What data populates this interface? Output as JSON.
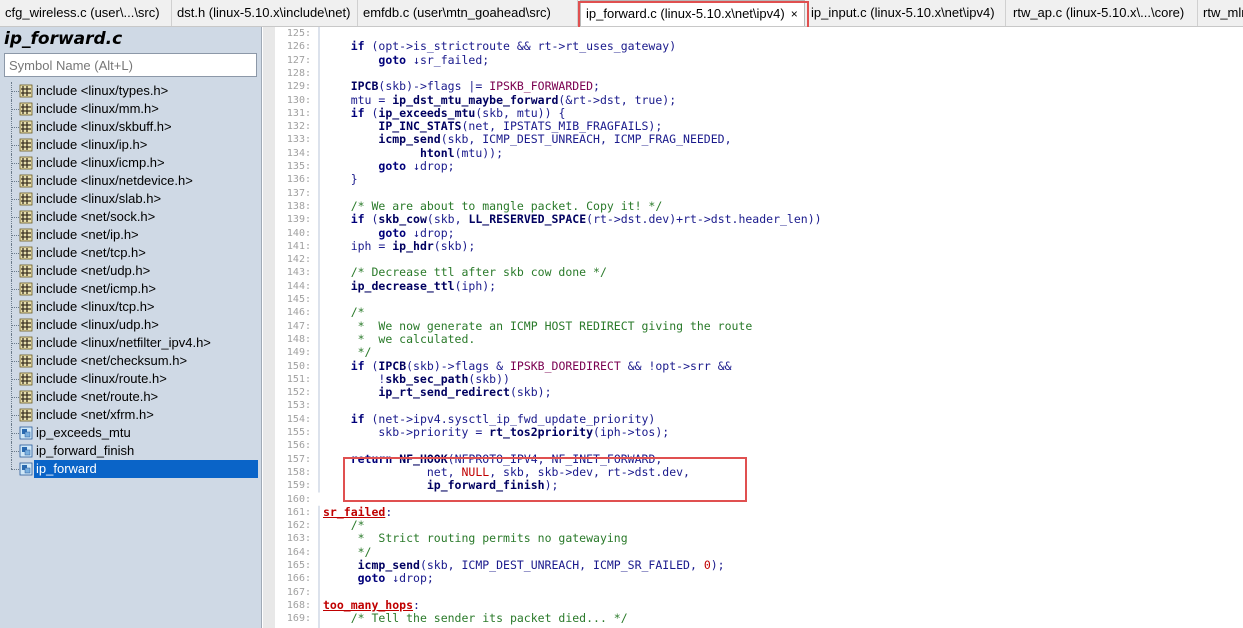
{
  "tabs": [
    {
      "label": "cfg_wireless.c (user\\...\\src)",
      "active": false
    },
    {
      "label": "dst.h (linux-5.10.x\\include\\net)",
      "active": false
    },
    {
      "label": "emfdb.c (user\\mtn_goahead\\src)",
      "active": false
    },
    {
      "label": "ip_forward.c (linux-5.10.x\\net\\ipv4)",
      "active": true
    },
    {
      "label": "ip_input.c (linux-5.10.x\\net\\ipv4)",
      "active": false
    },
    {
      "label": "rtw_ap.c (linux-5.10.x\\...\\core)",
      "active": false
    },
    {
      "label": "rtw_mlme",
      "active": false
    }
  ],
  "tab_close_glyph": "×",
  "panel": {
    "title": "ip_forward.c",
    "search_placeholder": "Symbol Name (Alt+L)",
    "symbols": [
      {
        "label": "include <linux/types.h>",
        "kind": "include",
        "selected": false
      },
      {
        "label": "include <linux/mm.h>",
        "kind": "include",
        "selected": false
      },
      {
        "label": "include <linux/skbuff.h>",
        "kind": "include",
        "selected": false
      },
      {
        "label": "include <linux/ip.h>",
        "kind": "include",
        "selected": false
      },
      {
        "label": "include <linux/icmp.h>",
        "kind": "include",
        "selected": false
      },
      {
        "label": "include <linux/netdevice.h>",
        "kind": "include",
        "selected": false
      },
      {
        "label": "include <linux/slab.h>",
        "kind": "include",
        "selected": false
      },
      {
        "label": "include <net/sock.h>",
        "kind": "include",
        "selected": false
      },
      {
        "label": "include <net/ip.h>",
        "kind": "include",
        "selected": false
      },
      {
        "label": "include <net/tcp.h>",
        "kind": "include",
        "selected": false
      },
      {
        "label": "include <net/udp.h>",
        "kind": "include",
        "selected": false
      },
      {
        "label": "include <net/icmp.h>",
        "kind": "include",
        "selected": false
      },
      {
        "label": "include <linux/tcp.h>",
        "kind": "include",
        "selected": false
      },
      {
        "label": "include <linux/udp.h>",
        "kind": "include",
        "selected": false
      },
      {
        "label": "include <linux/netfilter_ipv4.h>",
        "kind": "include",
        "selected": false
      },
      {
        "label": "include <net/checksum.h>",
        "kind": "include",
        "selected": false
      },
      {
        "label": "include <linux/route.h>",
        "kind": "include",
        "selected": false
      },
      {
        "label": "include <net/route.h>",
        "kind": "include",
        "selected": false
      },
      {
        "label": "include <net/xfrm.h>",
        "kind": "include",
        "selected": false
      },
      {
        "label": "ip_exceeds_mtu",
        "kind": "function",
        "selected": false
      },
      {
        "label": "ip_forward_finish",
        "kind": "function",
        "selected": false
      },
      {
        "label": "ip_forward",
        "kind": "function",
        "selected": true
      }
    ]
  },
  "code": {
    "first_line": 125,
    "lines": [
      "",
      "    <k>if</k> (opt->is_strictroute && rt->rt_uses_gateway)",
      "        <k>goto</k> ↓sr_failed;",
      "",
      "    <f>IPCB</f>(skb)->flags |= <m>IPSKB_FORWARDED</m>;",
      "    mtu = <f>ip_dst_mtu_maybe_forward</f>(&rt->dst, true);",
      "    <k>if</k> (<f>ip_exceeds_mtu</f>(skb, mtu)) {",
      "        <f>IP_INC_STATS</f>(net, IPSTATS_MIB_FRAGFAILS);",
      "        <f>icmp_send</f>(skb, ICMP_DEST_UNREACH, ICMP_FRAG_NEEDED,",
      "              <f>htonl</f>(mtu));",
      "        <k>goto</k> ↓drop;",
      "    }",
      "",
      "    <c>/* We are about to mangle packet. Copy it! */</c>",
      "    <k>if</k> (<f>skb_cow</f>(skb, <f>LL_RESERVED_SPACE</f>(rt->dst.dev)+rt->dst.header_len))",
      "        <k>goto</k> ↓drop;",
      "    iph = <f>ip_hdr</f>(skb);",
      "",
      "    <c>/* Decrease ttl after skb cow done */</c>",
      "    <f>ip_decrease_ttl</f>(iph);",
      "",
      "    <c>/*</c>",
      "    <c> *  We now generate an ICMP HOST REDIRECT giving the route</c>",
      "    <c> *  we calculated.</c>",
      "    <c> */</c>",
      "    <k>if</k> (<f>IPCB</f>(skb)->flags & <m>IPSKB_DOREDIRECT</m> && !opt->srr &&",
      "        !<f>skb_sec_path</f>(skb))",
      "        <f>ip_rt_send_redirect</f>(skb);",
      "",
      "    <k>if</k> (net->ipv4.sysctl_ip_fwd_update_priority)",
      "        skb->priority = <f>rt_tos2priority</f>(iph->tos);",
      "",
      "    <k>return</k> <f>NF_HOOK</f>(NFPROTO_IPV4, NF_INET_FORWARD,",
      "               net, <n>NULL</n>, skb, skb->dev, rt->dst.dev,",
      "               <f>ip_forward_finish</f>);",
      "",
      "<l>sr_failed</l>:",
      "    <c>/*</c>",
      "    <c> *  Strict routing permits no gatewaying</c>",
      "    <c> */</c>",
      "     <f>icmp_send</f>(skb, ICMP_DEST_UNREACH, ICMP_SR_FAILED, <u>0</u>);",
      "     <k>goto</k> ↓drop;",
      "",
      "<l>too_many_hops</l>:",
      "    <c>/* Tell the sender its packet died... */</c>"
    ]
  }
}
